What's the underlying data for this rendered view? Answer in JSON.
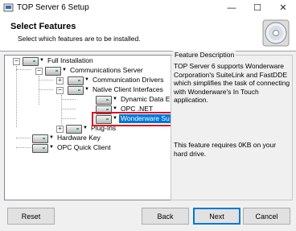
{
  "window": {
    "title": "TOP Server 6 Setup",
    "minimize": "—",
    "maximize": "☐",
    "close": "✕"
  },
  "header": {
    "title": "Select Features",
    "subtitle": "Select which features are to be installed."
  },
  "tree": {
    "nodes": [
      {
        "label": "Full Installation",
        "toggle": "−"
      },
      {
        "label": "Communications Server",
        "toggle": "−"
      },
      {
        "label": "Communication Drivers",
        "toggle": "+"
      },
      {
        "label": "Native Client Interfaces",
        "toggle": "−"
      },
      {
        "label": "Dynamic Data E"
      },
      {
        "label": "OPC .NET"
      },
      {
        "label": "Wonderware Su",
        "selected": true
      },
      {
        "label": "Plug-Ins",
        "toggle": "+"
      },
      {
        "label": "Hardware Key"
      },
      {
        "label": "OPC Quick Client"
      }
    ]
  },
  "description": {
    "legend": "Feature Description",
    "text": "TOP Server 6 supports Wonderware Corporation's SuiteLink and FastDDE which simplifies the task of connecting with Wonderware's In Touch application.",
    "requirement": "This feature requires 0KB on your hard drive."
  },
  "buttons": {
    "reset": "Reset",
    "back": "Back",
    "next": "Next",
    "cancel": "Cancel"
  },
  "colors": {
    "selection": "#0078d7",
    "highlight_box": "#d9121f"
  }
}
